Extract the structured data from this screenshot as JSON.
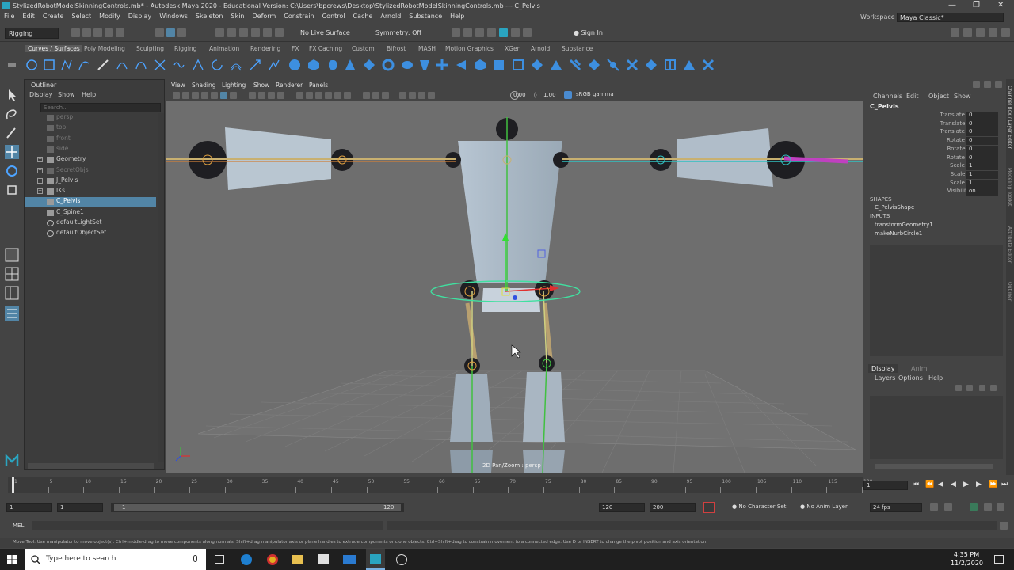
{
  "window": {
    "title": "StylizedRobotModelSkinningControls.mb* - Autodesk Maya 2020 - Educational Version: C:\\Users\\bpcrews\\Desktop\\StylizedRobotModelSkinningControls.mb  ---  C_Pelvis"
  },
  "menubar": {
    "items": [
      "File",
      "Edit",
      "Create",
      "Select",
      "Modify",
      "Display",
      "Windows",
      "Skeleton",
      "Skin",
      "Deform",
      "Constrain",
      "Control",
      "Cache",
      "Arnold",
      "Substance",
      "Help"
    ],
    "workspace_label": "Workspace :",
    "workspace_value": "Maya Classic*"
  },
  "statusline": {
    "mode": "Rigging",
    "live_surface": "No Live Surface",
    "symmetry": "Symmetry: Off",
    "sign_in": "Sign In"
  },
  "shelf_tabs": [
    "Curves / Surfaces",
    "Poly Modeling",
    "Sculpting",
    "Rigging",
    "Animation",
    "Rendering",
    "FX",
    "FX Caching",
    "Custom",
    "Bifrost",
    "MASH",
    "Motion Graphics",
    "XGen",
    "Arnold",
    "Substance"
  ],
  "outliner": {
    "title": "Outliner",
    "menu": [
      "Display",
      "Show",
      "Help"
    ],
    "search_placeholder": "Search...",
    "items": [
      {
        "label": "persp",
        "dim": true
      },
      {
        "label": "top",
        "dim": true
      },
      {
        "label": "front",
        "dim": true
      },
      {
        "label": "side",
        "dim": true
      },
      {
        "label": "Geometry",
        "dim": false
      },
      {
        "label": "SecretObjs",
        "dim": true
      },
      {
        "label": "J_Pelvis",
        "dim": false
      },
      {
        "label": "IKs",
        "dim": false
      },
      {
        "label": "C_Pelvis",
        "dim": false,
        "selected": true
      },
      {
        "label": "C_Spine1",
        "dim": false
      },
      {
        "label": "defaultLightSet",
        "dim": false
      },
      {
        "label": "defaultObjectSet",
        "dim": false
      }
    ]
  },
  "viewport": {
    "menu": [
      "View",
      "Shading",
      "Lighting",
      "Show",
      "Renderer",
      "Panels"
    ],
    "value_a": "0.00",
    "value_b": "1.00",
    "color_space": "sRGB gamma",
    "hud": "2D Pan/Zoom : persp"
  },
  "channelbox": {
    "menu": [
      "Channels",
      "Edit",
      "Object",
      "Show"
    ],
    "object": "C_Pelvis",
    "channels": [
      {
        "name": "Translate X",
        "value": "0"
      },
      {
        "name": "Translate Y",
        "value": "0"
      },
      {
        "name": "Translate Z",
        "value": "0"
      },
      {
        "name": "Rotate X",
        "value": "0"
      },
      {
        "name": "Rotate Y",
        "value": "0"
      },
      {
        "name": "Rotate Z",
        "value": "0"
      },
      {
        "name": "Scale X",
        "value": "1"
      },
      {
        "name": "Scale Y",
        "value": "1"
      },
      {
        "name": "Scale Z",
        "value": "1"
      },
      {
        "name": "Visibility",
        "value": "on"
      }
    ],
    "shapes_header": "SHAPES",
    "shape": "C_PelvisShape",
    "inputs_header": "INPUTS",
    "inputs": [
      "transformGeometry1",
      "makeNurbCircle1"
    ]
  },
  "layers": {
    "tabs": [
      "Display",
      "Anim"
    ],
    "menu": [
      "Layers",
      "Options",
      "Help"
    ]
  },
  "timeslider": {
    "ticks": [
      "1",
      "5",
      "10",
      "15",
      "20",
      "25",
      "30",
      "35",
      "40",
      "45",
      "50",
      "55",
      "60",
      "65",
      "70",
      "75",
      "80",
      "85",
      "90",
      "95",
      "100",
      "105",
      "110",
      "115",
      "120"
    ],
    "current_frame": "1"
  },
  "range": {
    "start": "1",
    "start_inner": "1",
    "slider_start": "1",
    "slider_end": "120",
    "end_inner": "120",
    "end": "200",
    "character_set": "No Character Set",
    "anim_layer": "No Anim Layer",
    "fps": "24 fps"
  },
  "cmdline": {
    "label": "MEL"
  },
  "helpline": {
    "text": "Move Tool: Use manipulator to move object(s). Ctrl+middle-drag to move components along normals. Shift+drag manipulator axis or plane handles to extrude components or clone objects. Ctrl+Shift+drag to constrain movement to a connected edge. Use D or INSERT to change the pivot position and axis orientation."
  },
  "taskbar": {
    "search_placeholder": "Type here to search",
    "time": "4:35 PM",
    "date": "11/2/2020"
  },
  "side_tabs": [
    "Channel Box / Layer Editor",
    "Modeling Toolkit",
    "Attribute Editor",
    "Outliner"
  ],
  "colors": {
    "selection": "#5285a6",
    "viewport_bg": "#6e6e6e",
    "ui_bg": "#444444",
    "maya_accent": "#2aa4c0"
  }
}
